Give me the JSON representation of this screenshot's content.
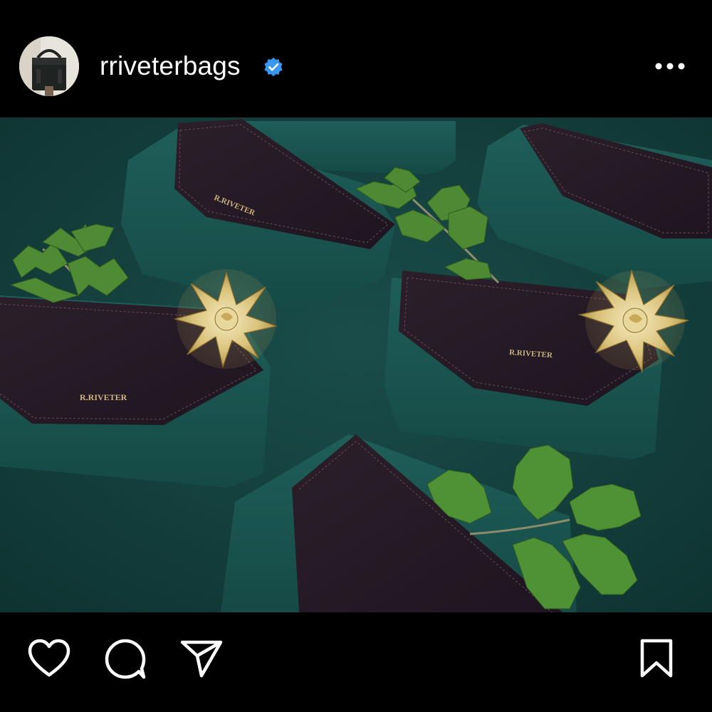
{
  "post": {
    "username": "rriveterbags",
    "verified": true,
    "photo_brand_text": "R.RIVETER"
  },
  "icons": {
    "verified": "verified-badge-icon",
    "more": "more-options-icon",
    "like": "heart-icon",
    "comment": "comment-icon",
    "share": "send-icon",
    "save": "bookmark-icon"
  },
  "colors": {
    "background": "#000000",
    "verified_blue": "#3897f0",
    "photo_teal": "#1a4a47"
  }
}
